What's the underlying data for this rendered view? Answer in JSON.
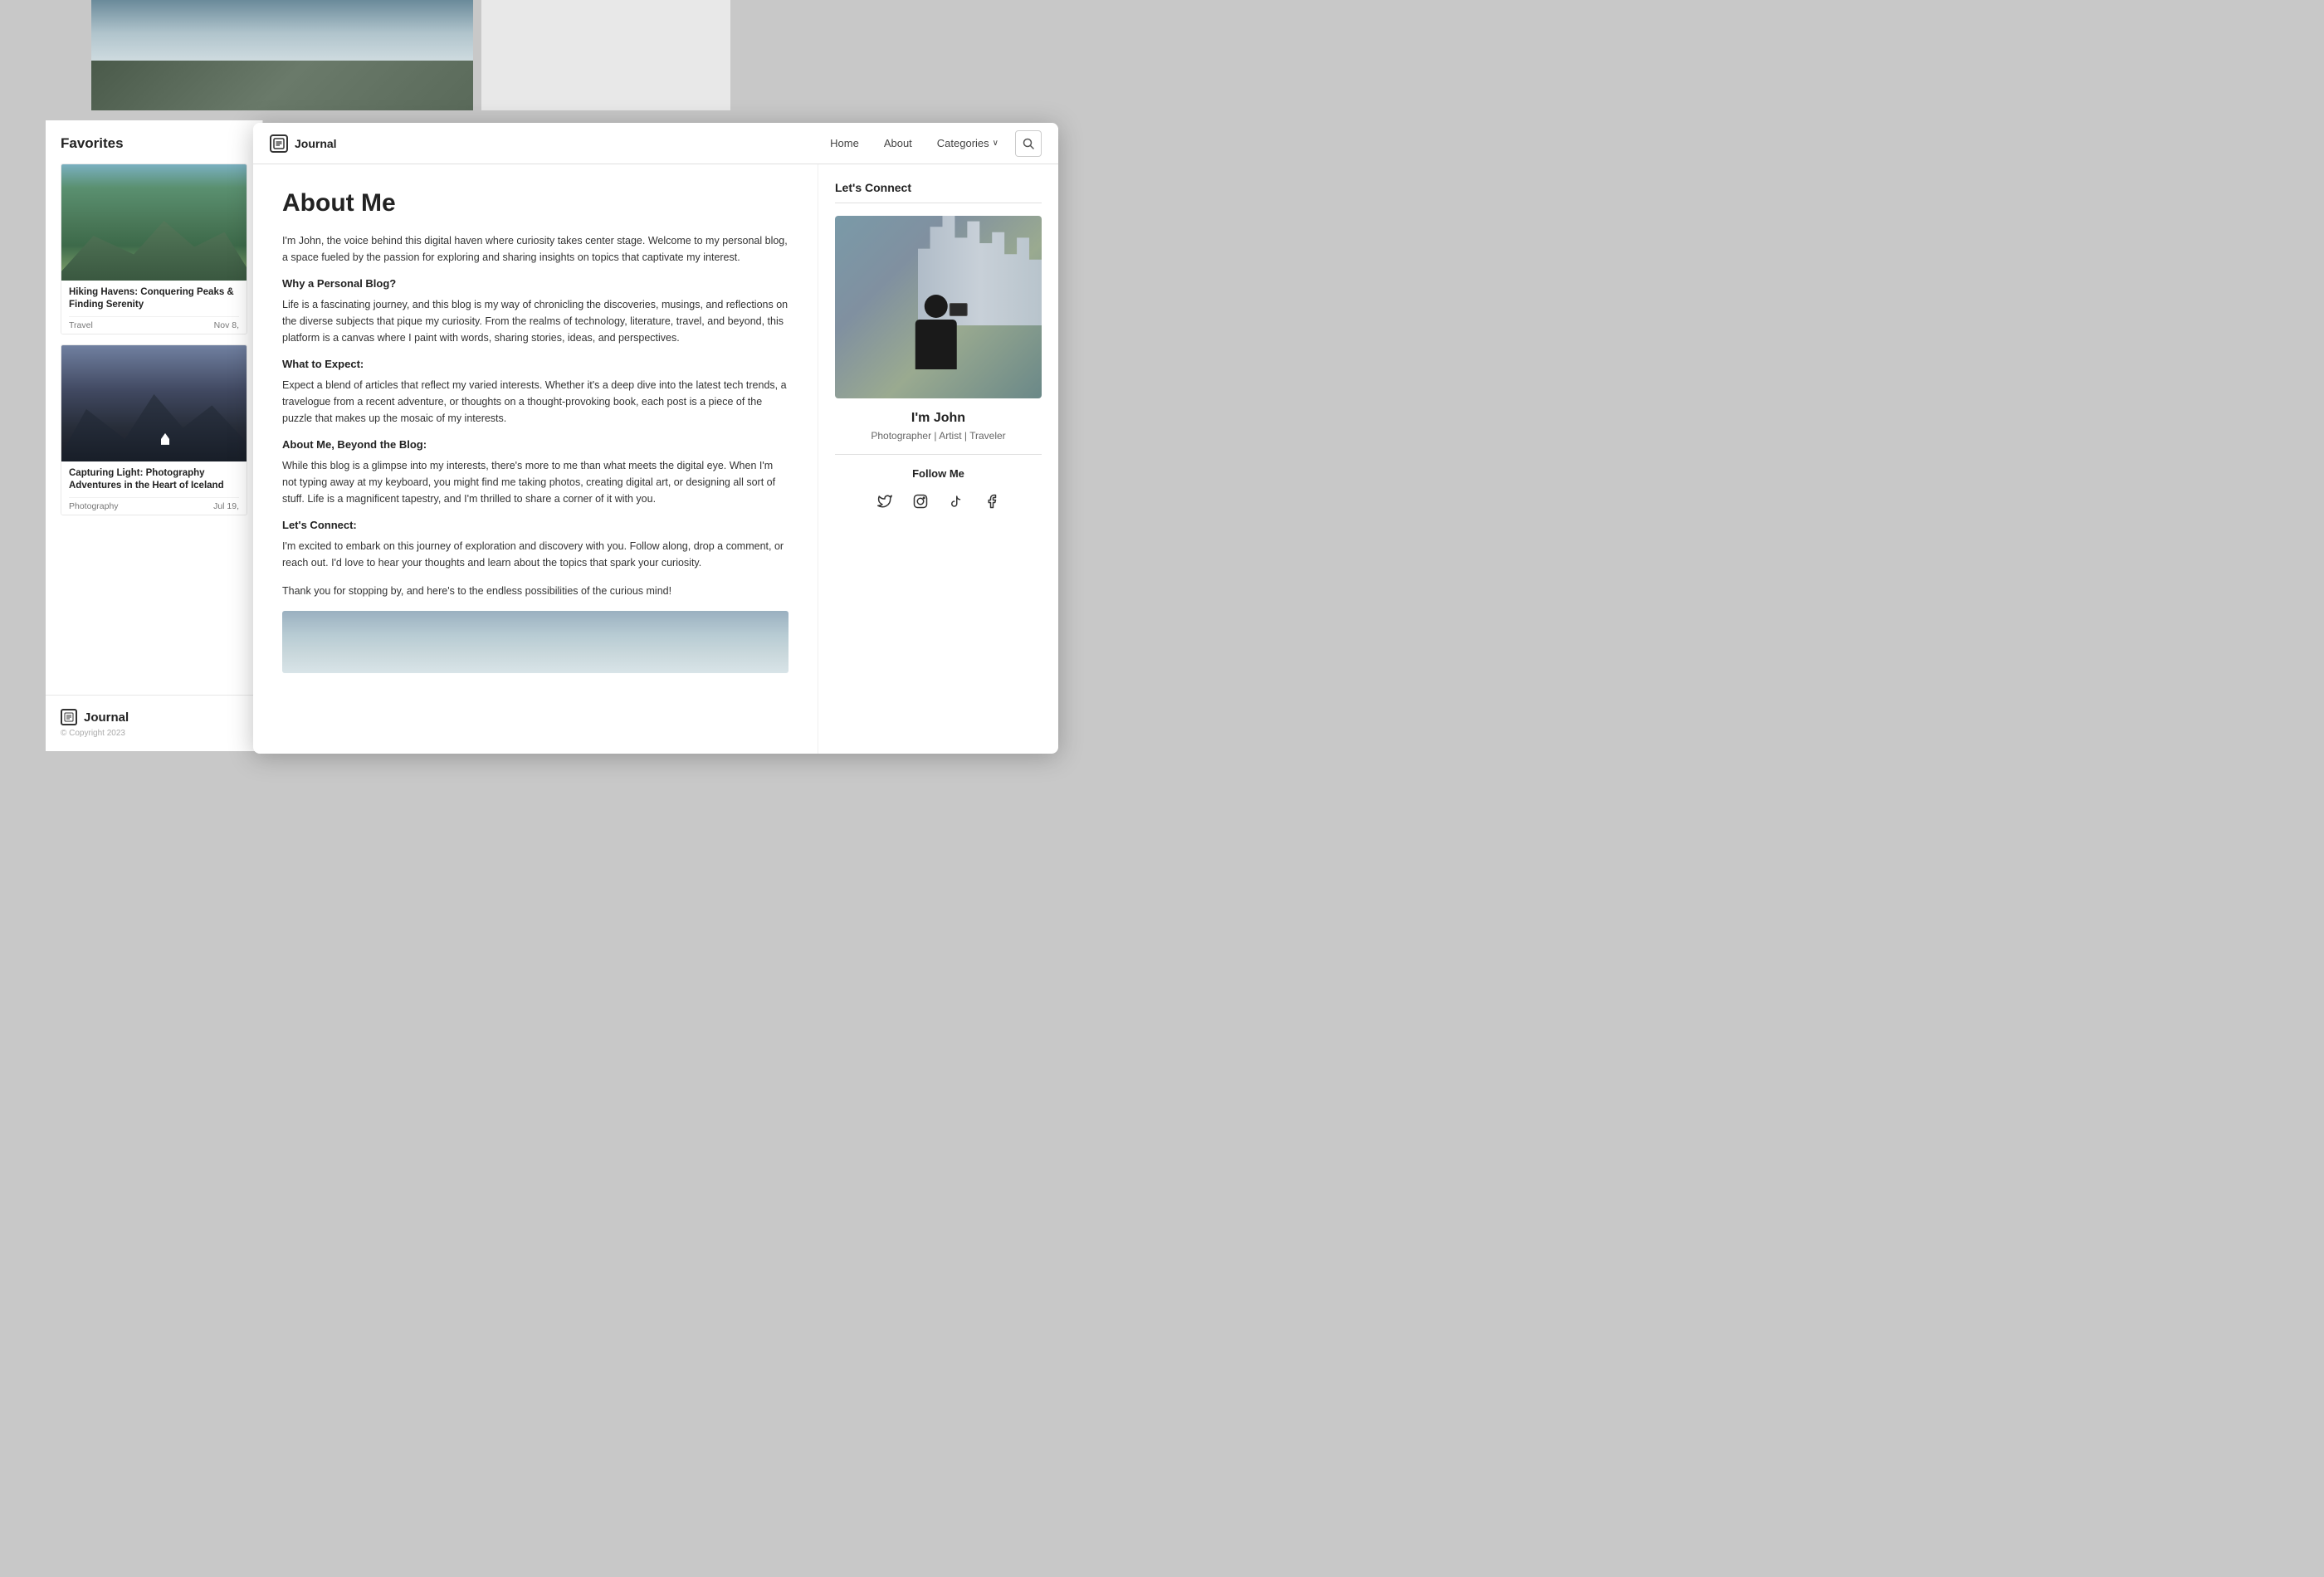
{
  "background": {
    "color": "#c8c8c8"
  },
  "topBgImage": {
    "altText": "mountain photography scene"
  },
  "sidebar": {
    "favorites_title": "Favorites",
    "card1": {
      "title": "Hiking Havens: Conquering Peaks & Finding Serenity",
      "category": "Travel",
      "date": "Nov 8,"
    },
    "card2": {
      "title": "Capturing Light: Photography Adventures in the Heart of Iceland",
      "category": "Photography",
      "date": "Jul 19,"
    },
    "footer": {
      "logo_text": "Journal",
      "copyright": "© Copyright 2023"
    }
  },
  "browser": {
    "navbar": {
      "logo_text": "Journal",
      "nav_home": "Home",
      "nav_about": "About",
      "nav_categories": "Categories",
      "nav_categories_arrow": "∨"
    },
    "main": {
      "page_title": "About Me",
      "intro": "I'm John, the voice behind this digital haven where curiosity takes center stage. Welcome to my personal blog, a space fueled by the passion for exploring and sharing insights on topics that captivate my interest.",
      "section1_heading": "Why a Personal Blog?",
      "section1_text": "Life is a fascinating journey, and this blog is my way of chronicling the discoveries, musings, and reflections on the diverse subjects that pique my curiosity. From the realms of technology, literature, travel, and beyond, this platform is a canvas where I paint with words, sharing stories, ideas, and perspectives.",
      "section2_heading": "What to Expect:",
      "section2_text": "Expect a blend of articles that reflect my varied interests. Whether it's a deep dive into the latest tech trends, a travelogue from a recent adventure, or thoughts on a thought-provoking book, each post is a piece of the puzzle that makes up the mosaic of my interests.",
      "section3_heading": "About Me, Beyond the Blog:",
      "section3_text": "While this blog is a glimpse into my interests, there's more to me than what meets the digital eye. When I'm not typing away at my keyboard, you might find me taking photos, creating digital art, or designing all sort of stuff. Life is a magnificent tapestry, and I'm thrilled to share a corner of it with you.",
      "section4_heading": "Let's Connect:",
      "section4_text": "I'm excited to embark on this journey of exploration and discovery with you. Follow along, drop a comment, or reach out. I'd love to hear your thoughts and learn about the topics that spark your curiosity.",
      "closing_text": "Thank you for stopping by, and here's to the endless possibilities of the curious mind!"
    },
    "sidebar": {
      "connect_title": "Let's Connect",
      "profile_name": "I'm John",
      "profile_tagline": "Photographer | Artist | Traveler",
      "follow_title": "Follow Me",
      "social": {
        "twitter": "🐦",
        "instagram": "📷",
        "tiktok": "🎵",
        "facebook": "👤"
      }
    }
  }
}
